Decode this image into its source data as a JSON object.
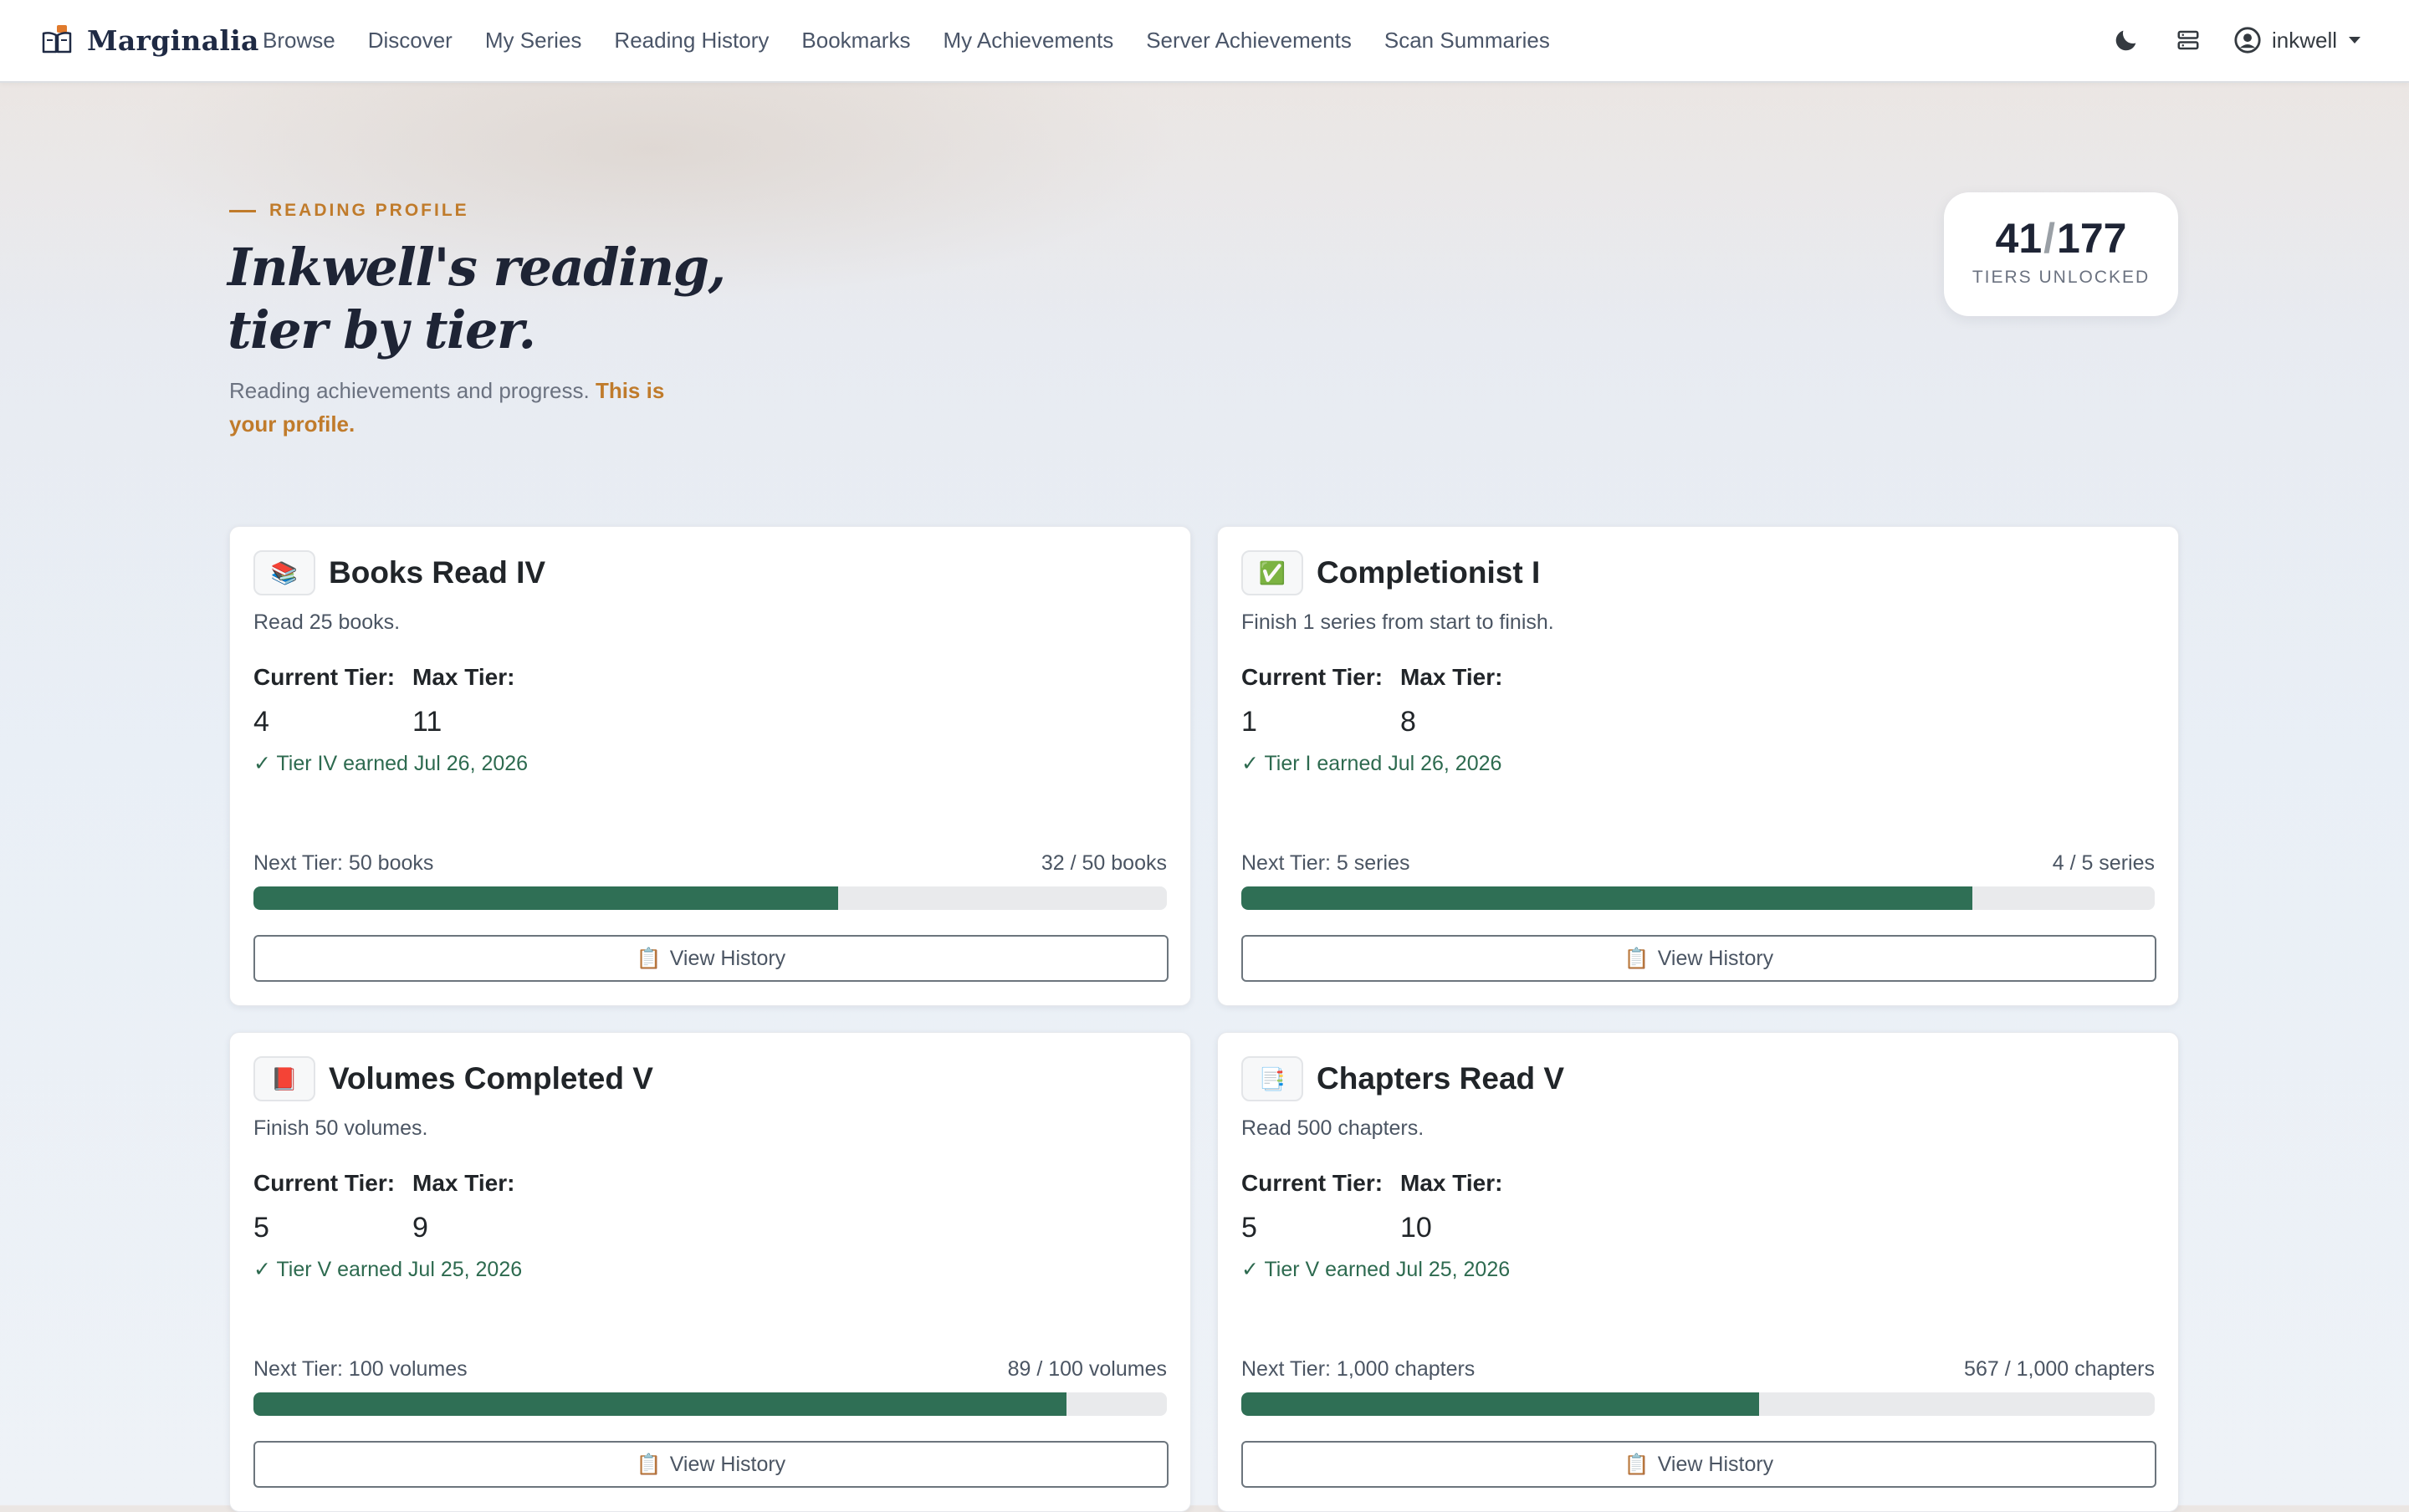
{
  "nav": {
    "brand": "Marginalia",
    "links": [
      "Browse",
      "Discover",
      "My Series",
      "Reading History",
      "Bookmarks",
      "My Achievements",
      "Server Achievements",
      "Scan Summaries"
    ],
    "username": "inkwell",
    "icons": [
      "moon-icon",
      "server-icon",
      "user-circle-icon"
    ]
  },
  "header": {
    "eyebrow": "READING PROFILE",
    "title_line1": "Inkwell's reading,",
    "title_line2": "tier by tier.",
    "subtitle": "Reading achievements and progress.",
    "subtitle_highlight": "This is your profile.",
    "tiers_unlocked": "41",
    "tiers_total": "177",
    "tiers_label": "TIERS UNLOCKED"
  },
  "labels": {
    "current_tier": "Current Tier:",
    "max_tier": "Max Tier:",
    "view_history": "View History"
  },
  "cards": [
    {
      "emoji": "📚",
      "title": "Books Read IV",
      "desc": "Read 25 books.",
      "current": "4",
      "max": "11",
      "earned": "✓ Tier IV earned Jul 26, 2026",
      "next": "Next Tier: 50 books",
      "count": "32 / 50 books",
      "progress": 0.64
    },
    {
      "emoji": "✅",
      "title": "Completionist I",
      "desc": "Finish 1 series from start to finish.",
      "current": "1",
      "max": "8",
      "earned": "✓ Tier I earned Jul 26, 2026",
      "next": "Next Tier: 5 series",
      "count": "4 / 5 series",
      "progress": 0.8
    },
    {
      "emoji": "📕",
      "title": "Volumes Completed V",
      "desc": "Finish 50 volumes.",
      "current": "5",
      "max": "9",
      "earned": "✓ Tier V earned Jul 25, 2026",
      "next": "Next Tier: 100 volumes",
      "count": "89 / 100 volumes",
      "progress": 0.89
    },
    {
      "emoji": "📑",
      "title": "Chapters Read V",
      "desc": "Read 500 chapters.",
      "current": "5",
      "max": "10",
      "earned": "✓ Tier V earned Jul 25, 2026",
      "next": "Next Tier: 1,000 chapters",
      "count": "567 / 1,000 chapters",
      "progress": 0.567
    }
  ],
  "colors": {
    "accent": "#c07b2b",
    "progress": "#2f6f55",
    "earned": "#2d6a4f",
    "title": "#1e2435"
  }
}
